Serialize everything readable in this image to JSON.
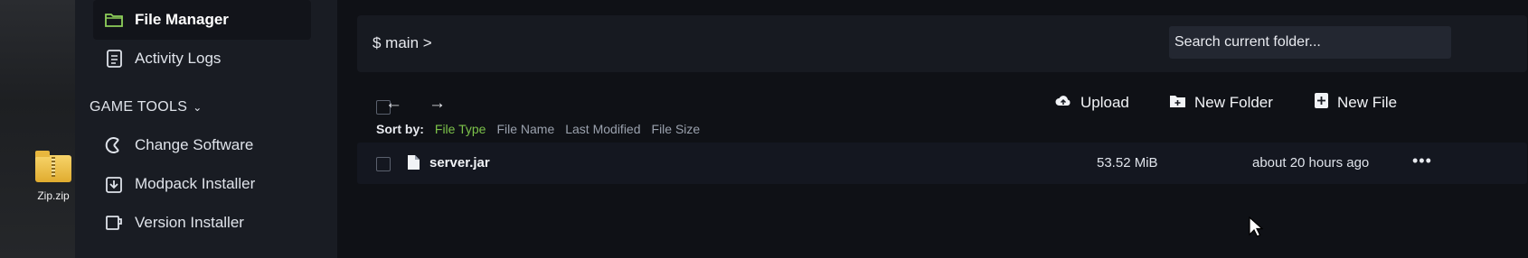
{
  "desktop": {
    "zip_label": "Zip.zip"
  },
  "sidebar": {
    "items": [
      {
        "label": "File Manager",
        "icon": "folder-icon"
      },
      {
        "label": "Activity Logs",
        "icon": "document-icon"
      }
    ],
    "section_title": "GAME TOOLS",
    "tools": [
      {
        "label": "Change Software",
        "icon": "software-icon"
      },
      {
        "label": "Modpack Installer",
        "icon": "download-icon"
      },
      {
        "label": "Version Installer",
        "icon": "cup-icon"
      }
    ]
  },
  "path": {
    "text": "$ main >"
  },
  "search": {
    "placeholder": "Search current folder..."
  },
  "toolbar": {
    "upload": "Upload",
    "new_folder": "New Folder",
    "new_file": "New File"
  },
  "sort": {
    "label": "Sort by:",
    "options": [
      "File Type",
      "File Name",
      "Last Modified",
      "File Size"
    ],
    "active": "File Type"
  },
  "files": [
    {
      "name": "server.jar",
      "size": "53.52 MiB",
      "modified": "about 20 hours ago"
    }
  ],
  "colors": {
    "accent": "#7cc24a",
    "background": "#0f1116",
    "panel": "#171a21"
  }
}
